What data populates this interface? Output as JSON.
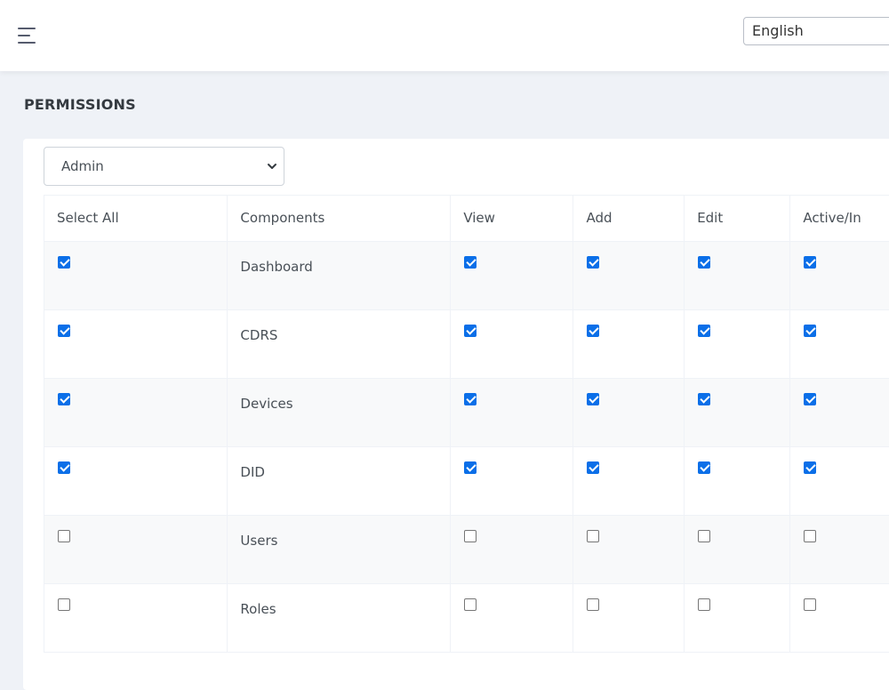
{
  "header": {
    "menu_icon": "hamburger-icon",
    "language_selected": "English"
  },
  "page": {
    "title": "PERMISSIONS"
  },
  "role_select": {
    "selected": "Admin",
    "icon": "chevron-down-icon"
  },
  "table": {
    "headers": {
      "select_all": "Select All",
      "components": "Components",
      "view": "View",
      "add": "Add",
      "edit": "Edit",
      "active": "Active/In"
    },
    "rows": [
      {
        "component": "Dashboard",
        "select_all": true,
        "view": true,
        "add": true,
        "edit": true,
        "active": true
      },
      {
        "component": "CDRS",
        "select_all": true,
        "view": true,
        "add": true,
        "edit": true,
        "active": true
      },
      {
        "component": "Devices",
        "select_all": true,
        "view": true,
        "add": true,
        "edit": true,
        "active": true
      },
      {
        "component": "DID",
        "select_all": true,
        "view": true,
        "add": true,
        "edit": true,
        "active": true
      },
      {
        "component": "Users",
        "select_all": false,
        "view": false,
        "add": false,
        "edit": false,
        "active": false
      },
      {
        "component": "Roles",
        "select_all": false,
        "view": false,
        "add": false,
        "edit": false,
        "active": false
      }
    ]
  },
  "colors": {
    "accent": "#0b6fe8",
    "page_bg": "#eff2f7"
  }
}
